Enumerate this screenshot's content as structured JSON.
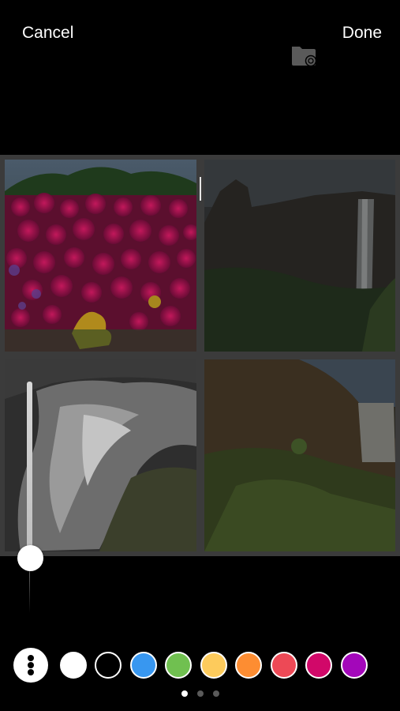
{
  "header": {
    "cancel_label": "Cancel",
    "done_label": "Done",
    "icon": "folder-add-icon"
  },
  "collage": {
    "photos": [
      {
        "name": "pink-flowers",
        "description_icon": "photo"
      },
      {
        "name": "waterfall-cliff",
        "description_icon": "photo"
      },
      {
        "name": "waterfall-water",
        "description_icon": "photo"
      },
      {
        "name": "mossy-hill-waterfall",
        "description_icon": "photo"
      }
    ]
  },
  "brush_slider": {
    "level": 0.1
  },
  "palette": {
    "more_icon": "more-vertical-icon",
    "colors": [
      "#ffffff",
      "#000000",
      "#3897f0",
      "#70c050",
      "#fdcb5c",
      "#fd8d32",
      "#ed4956",
      "#d10869",
      "#a307ba"
    ],
    "selected_index": 0
  },
  "pager": {
    "pages": 3,
    "current": 0
  }
}
